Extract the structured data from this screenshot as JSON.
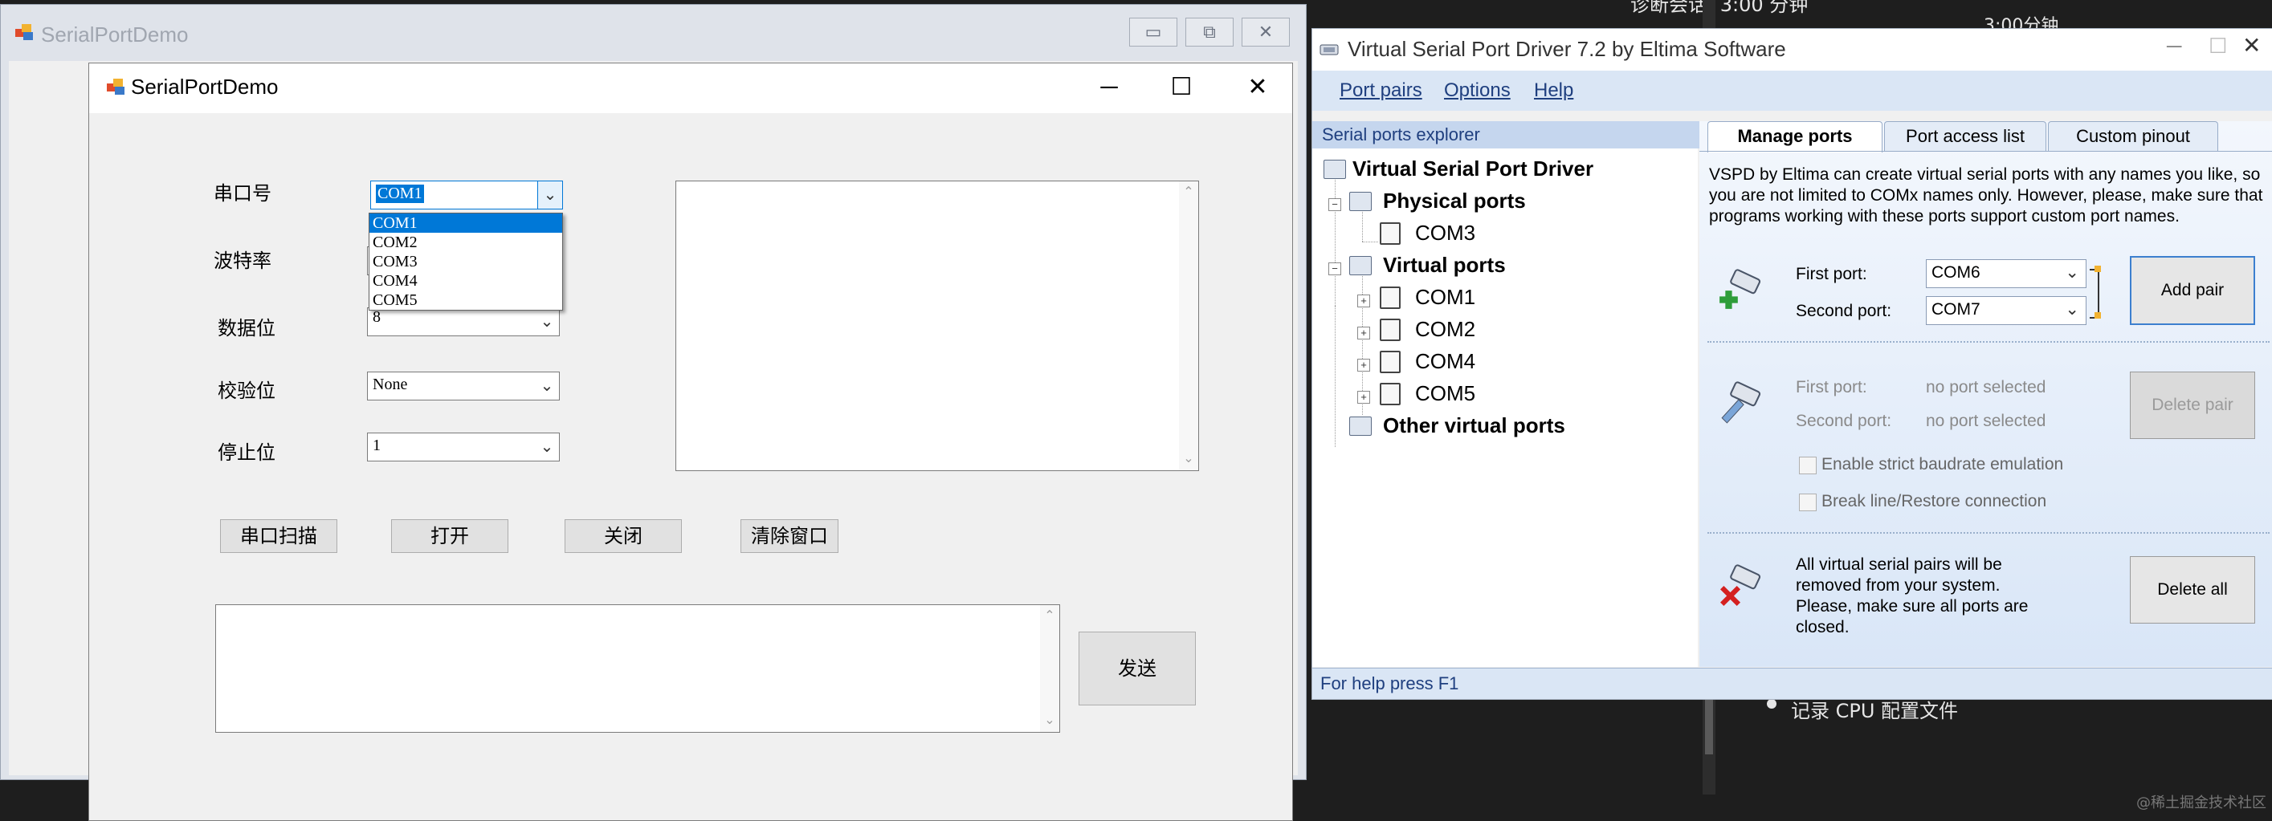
{
  "background": {
    "top_text": "诊断会话: 3:00 分钟",
    "time_label": "3:00分钟",
    "bullet_text": "记录 CPU 配置文件",
    "watermark": "@稀土掘金技术社区"
  },
  "outer_window": {
    "title": "SerialPortDemo"
  },
  "inner_window": {
    "title": "SerialPortDemo",
    "labels": {
      "port": "串口号",
      "baud": "波特率",
      "data_bits": "数据位",
      "parity": "校验位",
      "stop_bits": "停止位"
    },
    "port_combo_value": "COM1",
    "dropdown_options": [
      "COM1",
      "COM2",
      "COM3",
      "COM4",
      "COM5"
    ],
    "data_bits_value": "8",
    "parity_value": "None",
    "stop_bits_value": "1",
    "buttons": {
      "scan": "串口扫描",
      "open": "打开",
      "close": "关闭",
      "clear": "清除窗口",
      "send": "发送"
    }
  },
  "vspd": {
    "title": "Virtual Serial Port Driver 7.2 by Eltima Software",
    "menu": [
      "Port pairs",
      "Options",
      "Help"
    ],
    "explorer_header": "Serial ports explorer",
    "tree": {
      "root": "Virtual Serial Port Driver",
      "physical": "Physical ports",
      "physical_ports": [
        "COM3"
      ],
      "virtual": "Virtual ports",
      "virtual_ports": [
        "COM1",
        "COM2",
        "COM4",
        "COM5"
      ],
      "other": "Other virtual ports"
    },
    "tabs": [
      "Manage ports",
      "Port access list",
      "Custom pinout"
    ],
    "description": "VSPD by Eltima can create virtual serial ports with any names you like, so you are not limited to COMx names only. However, please, make sure that programs working with these ports support custom port names.",
    "add": {
      "first_label": "First port:",
      "first_value": "COM6",
      "second_label": "Second port:",
      "second_value": "COM7",
      "button": "Add pair"
    },
    "delete": {
      "first_label": "First port:",
      "first_value": "no port selected",
      "second_label": "Second port:",
      "second_value": "no port selected",
      "button": "Delete pair",
      "check1": "Enable strict baudrate emulation",
      "check2": "Break line/Restore connection"
    },
    "delete_all": {
      "text": "All virtual serial pairs will be removed from your system. Please, make sure all ports are closed.",
      "button": "Delete all"
    },
    "status": "For help press F1"
  }
}
